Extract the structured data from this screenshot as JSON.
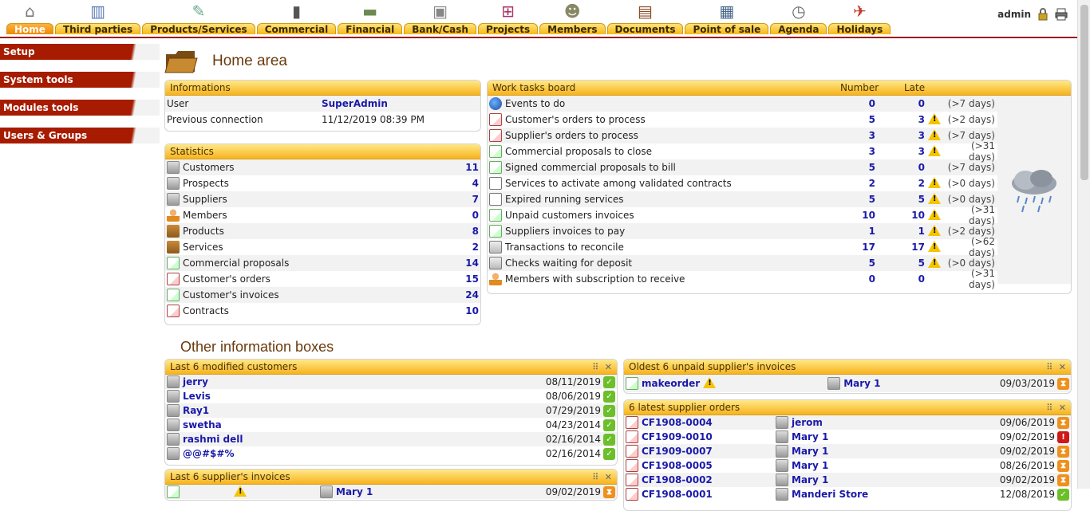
{
  "menu": [
    {
      "label": "Home",
      "icon": "home-icon",
      "active": true
    },
    {
      "label": "Third parties",
      "icon": "building-icon"
    },
    {
      "label": "Products/Services",
      "icon": "products-icon"
    },
    {
      "label": "Commercial",
      "icon": "briefcase-icon"
    },
    {
      "label": "Financial",
      "icon": "money-icon"
    },
    {
      "label": "Bank/Cash",
      "icon": "safe-icon"
    },
    {
      "label": "Projects",
      "icon": "org-chart-icon"
    },
    {
      "label": "Members",
      "icon": "members-icon"
    },
    {
      "label": "Documents",
      "icon": "documents-icon"
    },
    {
      "label": "Point of sale",
      "icon": "cash-register-icon"
    },
    {
      "label": "Agenda",
      "icon": "clock-icon"
    },
    {
      "label": "Holidays",
      "icon": "holidays-icon"
    }
  ],
  "user": {
    "name": "admin"
  },
  "left_menu": [
    "Setup",
    "System tools",
    "Modules tools",
    "Users & Groups"
  ],
  "page_title": "Home area",
  "info": {
    "title": "Informations",
    "rows": [
      {
        "label": "User",
        "value": "SuperAdmin"
      },
      {
        "label": "Previous connection",
        "value": "11/12/2019 08:39 PM"
      }
    ]
  },
  "stats": {
    "title": "Statistics",
    "rows": [
      {
        "label": "Customers",
        "value": "11",
        "icon": "bld"
      },
      {
        "label": "Prospects",
        "value": "4",
        "icon": "bld"
      },
      {
        "label": "Suppliers",
        "value": "7",
        "icon": "bld"
      },
      {
        "label": "Members",
        "value": "0",
        "icon": "person"
      },
      {
        "label": "Products",
        "value": "8",
        "icon": "box3d"
      },
      {
        "label": "Services",
        "value": "2",
        "icon": "box3d"
      },
      {
        "label": "Commercial proposals",
        "value": "14",
        "icon": "doc g"
      },
      {
        "label": "Customer's orders",
        "value": "15",
        "icon": "doc r"
      },
      {
        "label": "Customer's invoices",
        "value": "24",
        "icon": "doc g"
      },
      {
        "label": "Contracts",
        "value": "10",
        "icon": "doc r"
      }
    ]
  },
  "work": {
    "title": "Work tasks board",
    "col_number": "Number",
    "col_late": "Late",
    "rows": [
      {
        "label": "Events to do",
        "number": "0",
        "late": "0",
        "warn": false,
        "delay": "(>7 days)",
        "icon": "globe"
      },
      {
        "label": "Customer's orders to process",
        "number": "5",
        "late": "3",
        "warn": true,
        "delay": "(>2 days)",
        "icon": "doc r"
      },
      {
        "label": "Supplier's orders to process",
        "number": "3",
        "late": "3",
        "warn": true,
        "delay": "(>7 days)",
        "icon": "doc r"
      },
      {
        "label": "Commercial proposals to close",
        "number": "3",
        "late": "3",
        "warn": true,
        "delay": "(>31 days)",
        "icon": "doc g"
      },
      {
        "label": "Signed commercial proposals to bill",
        "number": "5",
        "late": "0",
        "warn": false,
        "delay": "(>7 days)",
        "icon": "doc g"
      },
      {
        "label": "Services to activate among validated contracts",
        "number": "2",
        "late": "2",
        "warn": true,
        "delay": "(>0 days)",
        "icon": "doc"
      },
      {
        "label": "Expired running services",
        "number": "5",
        "late": "5",
        "warn": true,
        "delay": "(>0 days)",
        "icon": "doc"
      },
      {
        "label": "Unpaid customers invoices",
        "number": "10",
        "late": "10",
        "warn": true,
        "delay": "(>31 days)",
        "icon": "doc g"
      },
      {
        "label": "Suppliers invoices to pay",
        "number": "1",
        "late": "1",
        "warn": true,
        "delay": "(>2 days)",
        "icon": "doc g"
      },
      {
        "label": "Transactions to reconcile",
        "number": "17",
        "late": "17",
        "warn": true,
        "delay": "(>62 days)",
        "icon": "check"
      },
      {
        "label": "Checks waiting for deposit",
        "number": "5",
        "late": "5",
        "warn": true,
        "delay": "(>0 days)",
        "icon": "check"
      },
      {
        "label": "Members with subscription to receive",
        "number": "0",
        "late": "0",
        "warn": false,
        "delay": "(>31 days)",
        "icon": "person"
      }
    ]
  },
  "other_title": "Other information boxes",
  "box_customers": {
    "title": "Last 6 modified customers",
    "rows": [
      {
        "name": "jerry",
        "date": "08/11/2019"
      },
      {
        "name": "Levis",
        "date": "08/06/2019"
      },
      {
        "name": "Ray1",
        "date": "07/29/2019"
      },
      {
        "name": "swetha",
        "date": "04/23/2014"
      },
      {
        "name": "rashmi dell",
        "date": "02/16/2014"
      },
      {
        "name": "@@#$#%",
        "date": "02/16/2014"
      }
    ]
  },
  "box_supplier_invoices": {
    "title": "Last 6 supplier's invoices",
    "rows": [
      {
        "ref": "",
        "party": "Mary 1",
        "date": "09/02/2019"
      }
    ]
  },
  "box_unpaid": {
    "title": "Oldest 6 unpaid supplier's invoices",
    "rows": [
      {
        "ref": "makeorder",
        "party": "Mary 1",
        "date": "09/03/2019"
      }
    ]
  },
  "box_orders": {
    "title": "6 latest supplier orders",
    "rows": [
      {
        "ref": "CF1908-0004",
        "party": "jerom",
        "date": "09/06/2019",
        "status": "wait"
      },
      {
        "ref": "CF1909-0010",
        "party": "Mary 1",
        "date": "09/02/2019",
        "status": "err"
      },
      {
        "ref": "CF1909-0007",
        "party": "Mary 1",
        "date": "09/02/2019",
        "status": "wait"
      },
      {
        "ref": "CF1908-0005",
        "party": "Mary 1",
        "date": "08/26/2019",
        "status": "wait"
      },
      {
        "ref": "CF1908-0002",
        "party": "Mary 1",
        "date": "09/02/2019",
        "status": "wait"
      },
      {
        "ref": "CF1908-0001",
        "party": "Manderi Store",
        "date": "12/08/2019",
        "status": "ok"
      }
    ]
  }
}
